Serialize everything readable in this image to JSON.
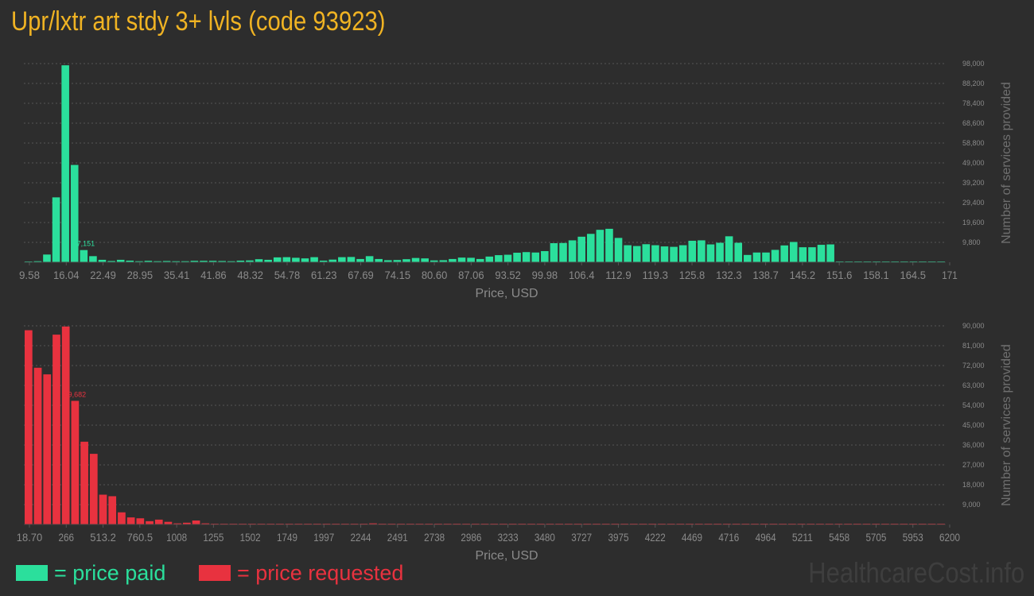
{
  "page": {
    "title": "Upr/lxtr art stdy 3+ lvls (code 93923)",
    "watermark": "HealthcareCost.info"
  },
  "legend": {
    "paid_label": "= price paid",
    "requested_label": "= price requested"
  },
  "colors": {
    "background": "#2d2d2d",
    "title": "#f0b323",
    "paid": "#2bdf9c",
    "requested": "#e8323f",
    "axis_text": "#8a8a8a",
    "grid": "#555555"
  },
  "chart_data": [
    {
      "type": "bar",
      "series_name": "price paid",
      "xlabel": "Price, USD",
      "ylabel": "Number of services provided",
      "ylim": [
        0,
        98000
      ],
      "y_ticks": [
        "9,800",
        "19,600",
        "29,400",
        "39,200",
        "49,000",
        "58,800",
        "68,600",
        "78,400",
        "88,200",
        "98,000"
      ],
      "x_ticks": [
        "9.58",
        "16.04",
        "22.49",
        "28.95",
        "35.41",
        "41.86",
        "48.32",
        "54.78",
        "61.23",
        "67.69",
        "74.15",
        "80.60",
        "87.06",
        "93.52",
        "99.98",
        "106.4",
        "112.9",
        "119.3",
        "125.8",
        "132.3",
        "138.7",
        "145.2",
        "151.6",
        "158.1",
        "164.5",
        "171"
      ],
      "peak_label": "97,151",
      "peak_index": 6,
      "values": [
        300,
        500,
        3800,
        32000,
        97151,
        48000,
        6000,
        3000,
        1200,
        600,
        1200,
        800,
        500,
        700,
        500,
        600,
        500,
        500,
        700,
        700,
        700,
        600,
        500,
        800,
        900,
        1500,
        1200,
        2400,
        2500,
        2200,
        1900,
        2500,
        800,
        1300,
        2500,
        2600,
        1600,
        3000,
        1600,
        1000,
        1100,
        1500,
        2100,
        1900,
        900,
        1000,
        1600,
        2300,
        2200,
        1600,
        2800,
        3500,
        3700,
        4700,
        5000,
        4800,
        5500,
        9400,
        9500,
        10800,
        12600,
        14000,
        16000,
        16500,
        12000,
        8400,
        8000,
        8900,
        8400,
        7800,
        7600,
        8400,
        10600,
        10800,
        8800,
        9600,
        12800,
        9600,
        3600,
        4800,
        4800,
        6100,
        8300,
        10000,
        7400,
        7400,
        8600,
        8800,
        400,
        300,
        300,
        300,
        300,
        300,
        300,
        300,
        300,
        300,
        300,
        300
      ]
    },
    {
      "type": "bar",
      "series_name": "price requested",
      "xlabel": "Price, USD",
      "ylabel": "Number of services provided",
      "ylim": [
        0,
        90000
      ],
      "y_ticks": [
        "9,000",
        "18,000",
        "27,000",
        "36,000",
        "45,000",
        "54,000",
        "63,000",
        "72,000",
        "81,000",
        "90,000"
      ],
      "x_ticks": [
        "18.70",
        "266",
        "513.2",
        "760.5",
        "1008",
        "1255",
        "1502",
        "1749",
        "1997",
        "2244",
        "2491",
        "2738",
        "2986",
        "3233",
        "3480",
        "3727",
        "3975",
        "4222",
        "4469",
        "4716",
        "4964",
        "5211",
        "5458",
        "5705",
        "5953",
        "6200"
      ],
      "peak_label": "89,682",
      "peak_index": 5,
      "values": [
        88000,
        71000,
        68000,
        86000,
        89682,
        56000,
        37500,
        32000,
        13500,
        12800,
        5500,
        3200,
        2800,
        1500,
        2200,
        1200,
        500,
        800,
        1800,
        500,
        300,
        200,
        200,
        200,
        250,
        200,
        200,
        200,
        150,
        150,
        150,
        150,
        150,
        100,
        100,
        100,
        300,
        500,
        100,
        100,
        100,
        100,
        100,
        100,
        100,
        100,
        100,
        100,
        100,
        100,
        100,
        100,
        100,
        100,
        100,
        100,
        100,
        100,
        100,
        100,
        100,
        100,
        100,
        100,
        100,
        100,
        100,
        100,
        100,
        100,
        100,
        100,
        100,
        100,
        100,
        100,
        100,
        100,
        100,
        100,
        100,
        100,
        100,
        100,
        100,
        100,
        100,
        100,
        100,
        100,
        100,
        100,
        100,
        100,
        100,
        100,
        100,
        100,
        200
      ]
    }
  ]
}
